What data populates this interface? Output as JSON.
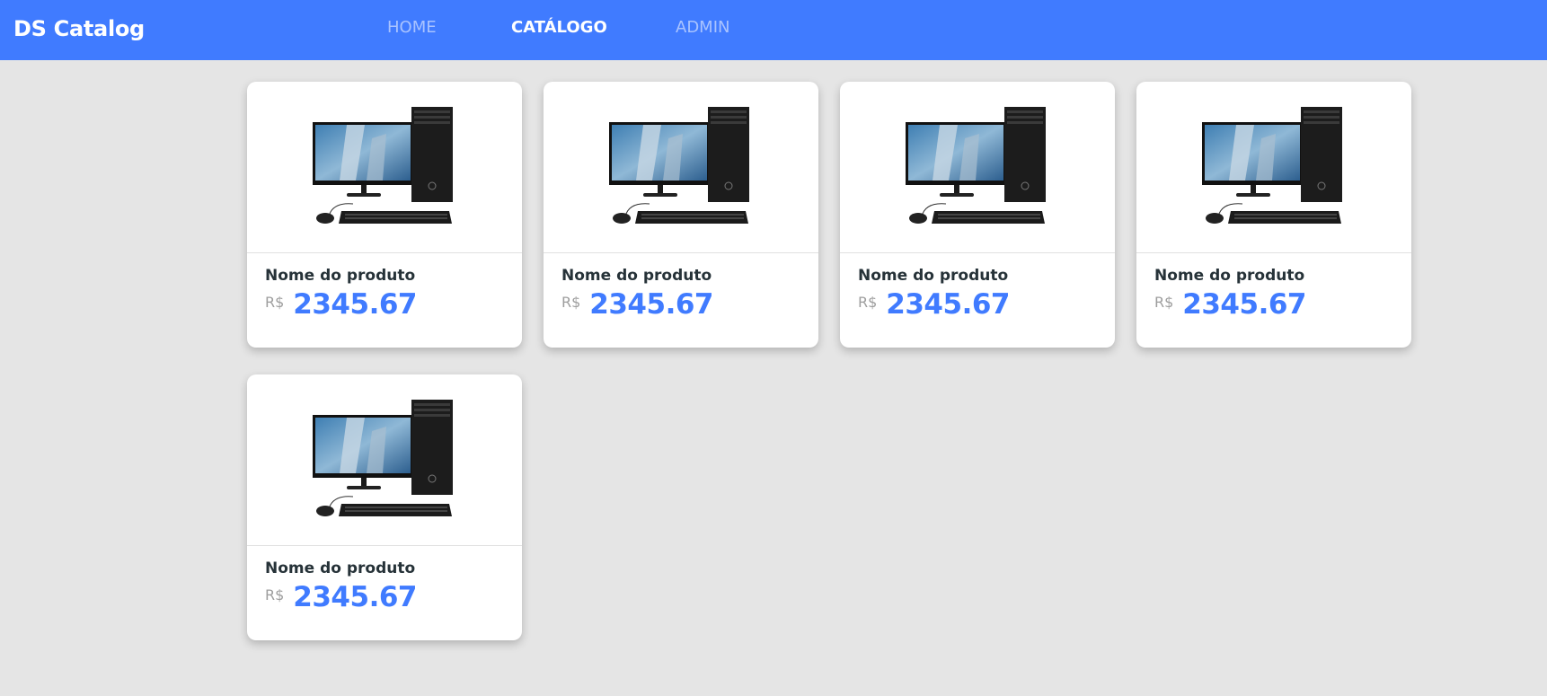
{
  "navbar": {
    "brand": "DS Catalog",
    "links": [
      {
        "label": "HOME",
        "active": false
      },
      {
        "label": "CATÁLOGO",
        "active": true
      },
      {
        "label": "ADMIN",
        "active": false
      }
    ],
    "color": "#407bff"
  },
  "products": [
    {
      "name": "Nome do produto",
      "currency": "R$",
      "price": "2345.67",
      "image": "desktop-computer-icon"
    },
    {
      "name": "Nome do produto",
      "currency": "R$",
      "price": "2345.67",
      "image": "desktop-computer-icon"
    },
    {
      "name": "Nome do produto",
      "currency": "R$",
      "price": "2345.67",
      "image": "desktop-computer-icon"
    },
    {
      "name": "Nome do produto",
      "currency": "R$",
      "price": "2345.67",
      "image": "desktop-computer-icon"
    },
    {
      "name": "Nome do produto",
      "currency": "R$",
      "price": "2345.67",
      "image": "desktop-computer-icon"
    }
  ],
  "colors": {
    "accent": "#407bff",
    "background": "#e5e5e5",
    "text": "#263238",
    "muted": "#9e9e9e"
  }
}
